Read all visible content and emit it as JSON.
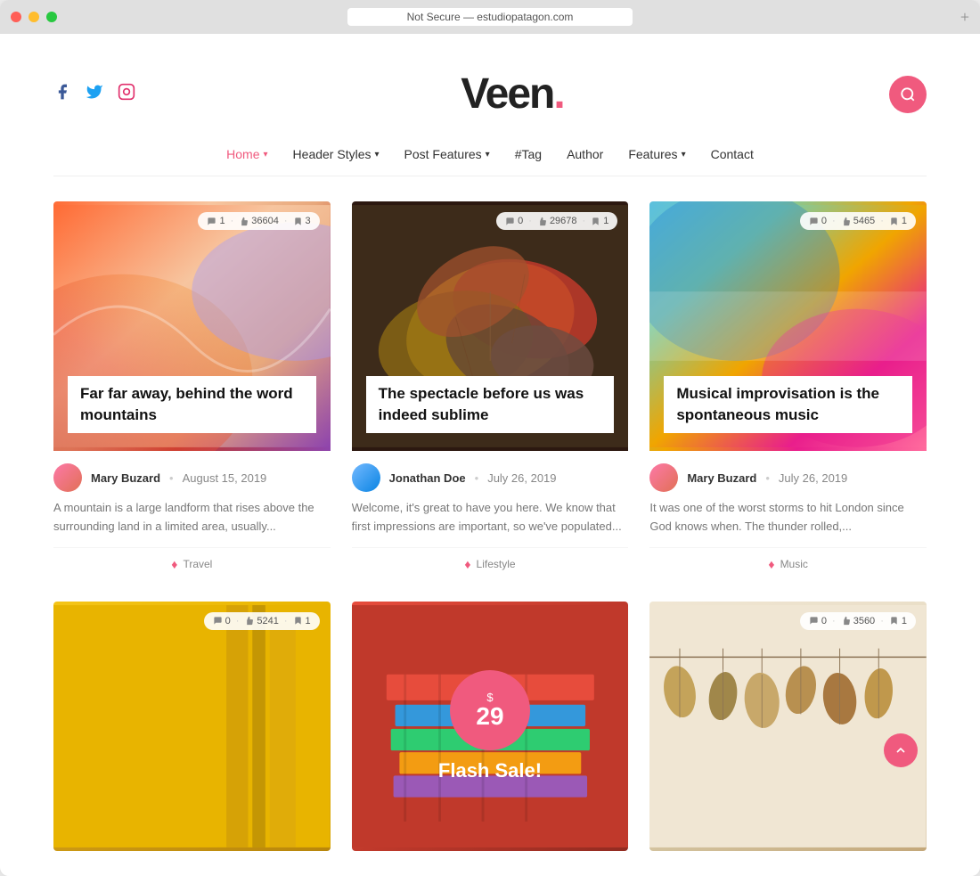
{
  "browser": {
    "url": "Not Secure — estudiopatagon.com",
    "new_tab_label": "+"
  },
  "site": {
    "logo": "Veen",
    "logo_dot": "."
  },
  "social": {
    "facebook": "f",
    "twitter": "𝕏",
    "instagram": "♡"
  },
  "nav": {
    "items": [
      {
        "label": "Home",
        "active": true,
        "has_dropdown": true
      },
      {
        "label": "Header Styles",
        "active": false,
        "has_dropdown": true
      },
      {
        "label": "Post Features",
        "active": false,
        "has_dropdown": true
      },
      {
        "label": "#Tag",
        "active": false,
        "has_dropdown": false
      },
      {
        "label": "Author",
        "active": false,
        "has_dropdown": false
      },
      {
        "label": "Features",
        "active": false,
        "has_dropdown": true
      },
      {
        "label": "Contact",
        "active": false,
        "has_dropdown": false
      }
    ]
  },
  "cards": [
    {
      "id": 1,
      "title": "Far far away, behind the word mountains",
      "author": "Mary Buzard",
      "date": "August 15, 2019",
      "excerpt": "A mountain is a large landform that rises above the surrounding land in a limited area, usually...",
      "category": "Travel",
      "stats": {
        "comments": "1",
        "likes": "36604",
        "bookmarks": "3"
      },
      "bg_class": "card-bg-1"
    },
    {
      "id": 2,
      "title": "The spectacle before us was indeed sublime",
      "author": "Jonathan Doe",
      "date": "July 26, 2019",
      "excerpt": "Welcome, it's great to have you here. We know that first impressions are important, so we've populated...",
      "category": "Lifestyle",
      "stats": {
        "comments": "0",
        "likes": "29678",
        "bookmarks": "1"
      },
      "bg_class": "card-bg-2 leaves-bg"
    },
    {
      "id": 3,
      "title": "Musical improvisation is the spontaneous music",
      "author": "Mary Buzard",
      "date": "July 26, 2019",
      "excerpt": "It was one of the worst storms to hit London since God knows when. The thunder rolled,...",
      "category": "Music",
      "stats": {
        "comments": "0",
        "likes": "5465",
        "bookmarks": "1"
      },
      "bg_class": "card-bg-3"
    },
    {
      "id": 4,
      "title": "",
      "author": "",
      "date": "",
      "excerpt": "",
      "category": "",
      "stats": {
        "comments": "0",
        "likes": "5241",
        "bookmarks": "1"
      },
      "bg_class": "card-bg-4"
    },
    {
      "id": 5,
      "flash_sale": true,
      "price": "$29",
      "flash_label": "Flash Sale!",
      "bg_class": "card-bg-5"
    },
    {
      "id": 6,
      "title": "",
      "stats": {
        "comments": "0",
        "likes": "3560",
        "bookmarks": "1"
      },
      "bg_class": "hanging-leaves-bg"
    }
  ],
  "scroll_top": "▲"
}
